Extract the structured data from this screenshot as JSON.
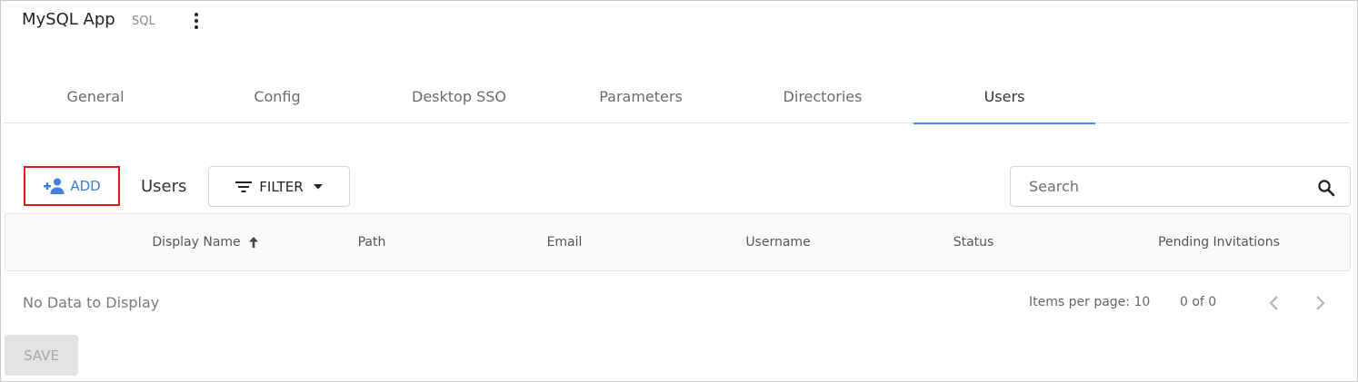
{
  "header": {
    "app_title": "MySQL App",
    "app_type": "SQL",
    "menu_icon": "more-vert-icon"
  },
  "tabs": [
    {
      "label": "General",
      "active": false
    },
    {
      "label": "Config",
      "active": false
    },
    {
      "label": "Desktop SSO",
      "active": false
    },
    {
      "label": "Parameters",
      "active": false
    },
    {
      "label": "Directories",
      "active": false
    },
    {
      "label": "Users",
      "active": true
    }
  ],
  "toolbar": {
    "add_label": "ADD",
    "add_icon": "person-add-icon",
    "section_label": "Users",
    "filter_label": "FILTER",
    "filter_icon": "filter-lines-icon",
    "search_placeholder": "Search",
    "search_icon": "search-icon"
  },
  "table": {
    "columns": [
      "Display Name",
      "Path",
      "Email",
      "Username",
      "Status",
      "Pending Invitations"
    ],
    "sort_column": "Display Name",
    "sort_direction": "ascending",
    "rows": []
  },
  "footer": {
    "empty_text": "No Data to Display",
    "items_per_page": "Items per page: 10",
    "range": "0 of 0",
    "save_label": "SAVE"
  },
  "colors": {
    "accent": "#4a86e8",
    "highlight_border": "#e0161b",
    "disabled_bg": "#e3e3e3"
  }
}
